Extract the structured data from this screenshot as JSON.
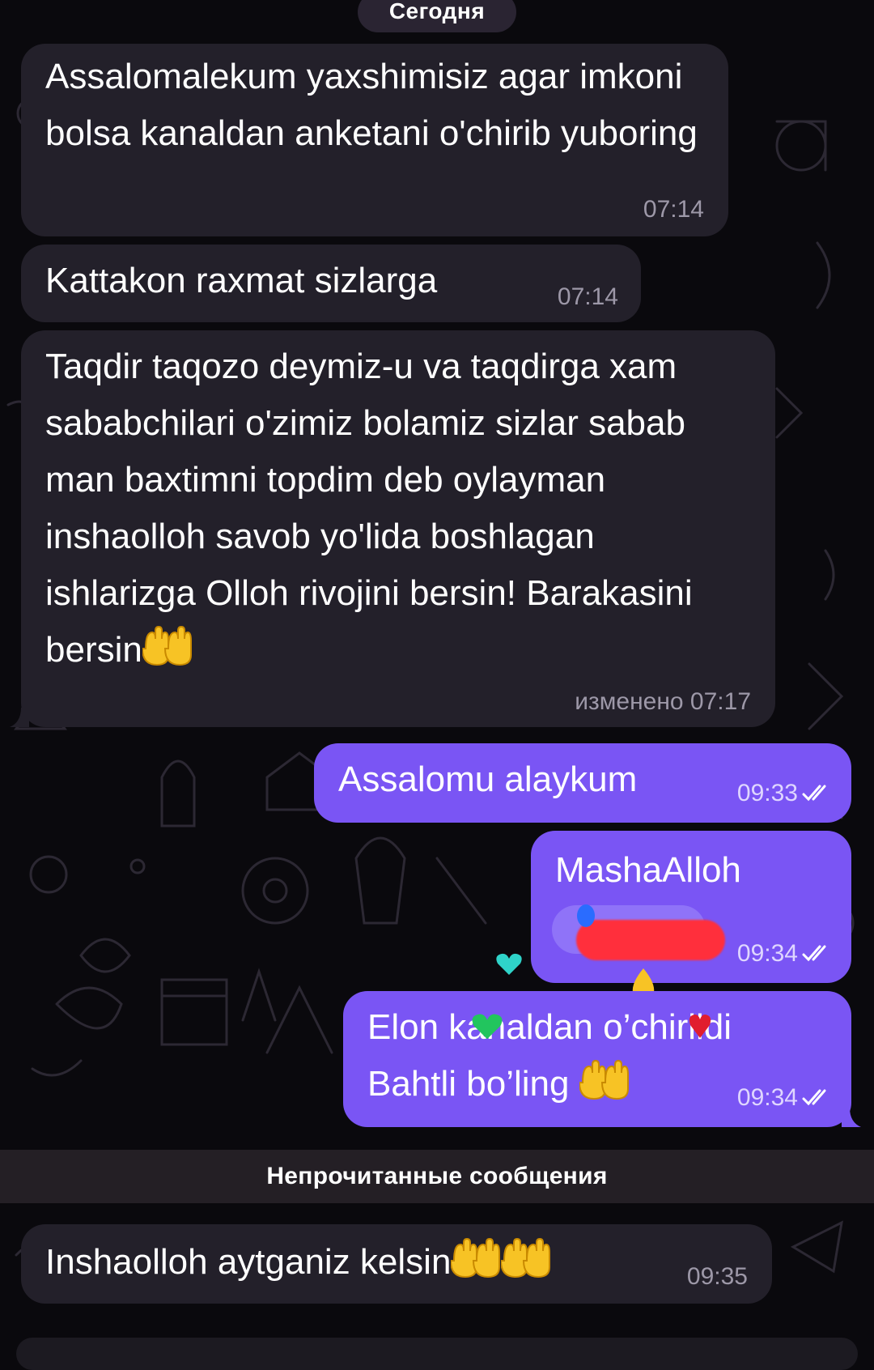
{
  "chat": {
    "date_label": "Сегодня",
    "unread_label": "Непрочитанные сообщения",
    "messages": [
      {
        "direction": "incoming",
        "text": "Assalomalekum yaxshimisiz agar imkoni bolsa kanaldan anketani o'chirib yuboring",
        "time": "07:14"
      },
      {
        "direction": "incoming",
        "text": "Kattakon raxmat sizlarga",
        "time": "07:14"
      },
      {
        "direction": "incoming",
        "text": "Taqdir taqozo deymiz-u va taqdirga xam sababchilari o'zimiz bolamiz sizlar sabab man baxtimni topdim deb oylayman inshaolloh savob yo'lida boshlagan ishlarizga Olloh rivojini bersin! Barakasini bersin",
        "emoji": "raising-hands",
        "time": "изменено 07:17"
      },
      {
        "direction": "outgoing",
        "text": "Assalomu alaykum",
        "time": "09:33",
        "status": "read"
      },
      {
        "direction": "outgoing",
        "text": "MashaAlloh",
        "time": "09:34",
        "status": "read",
        "reaction_redacted": true
      },
      {
        "direction": "outgoing",
        "line1": "Elon kanaldan o’chirildi",
        "line2": "Bahtli bo’ling",
        "emoji": "raising-hands",
        "time": "09:34",
        "status": "read"
      },
      {
        "direction": "incoming",
        "text": "Inshaolloh aytganiz kelsin",
        "emoji": "raising-hands x2",
        "time": "09:35"
      }
    ]
  },
  "colors": {
    "background": "#0a090d",
    "incoming_bubble": "#23202a",
    "outgoing_bubble": "#7a55f4",
    "unread_bar": "#241f25",
    "redaction": "#ff2f3c"
  },
  "icons": {
    "read_status": "double-check-icon",
    "emoji": "raising-hands-emoji",
    "hearts": [
      "cyan-heart-icon",
      "purple-heart-icon",
      "green-heart-icon",
      "red-heart-icon",
      "yellow-heart-icon",
      "blue-heart-icon"
    ]
  }
}
